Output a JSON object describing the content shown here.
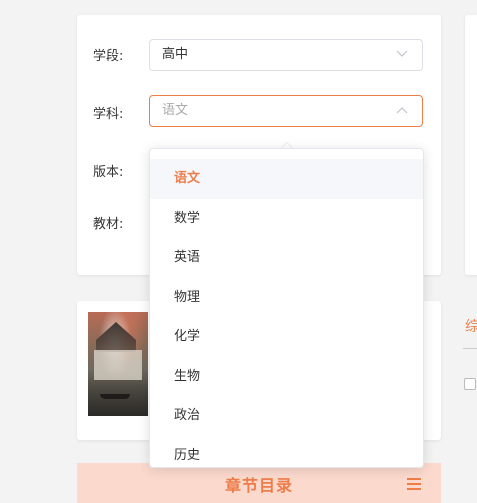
{
  "filters": {
    "stage_label": "学段:",
    "stage_value": "高中",
    "subject_label": "学科:",
    "subject_placeholder": "语文",
    "edition_label": "版本:",
    "textbook_label": "教材:"
  },
  "dropdown": {
    "options": [
      "语文",
      "数学",
      "英语",
      "物理",
      "化学",
      "生物",
      "政治",
      "历史"
    ],
    "selected": "语文"
  },
  "right_panel": {
    "title": "综"
  },
  "chapter": {
    "title": "章节目录"
  },
  "colors": {
    "accent": "#ee7d4a",
    "banner": "#fbd9cd"
  }
}
